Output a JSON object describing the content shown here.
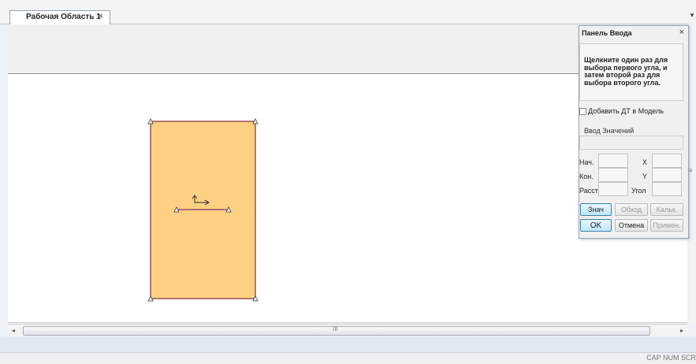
{
  "tabs": {
    "active_label": "Рабочая Область 1",
    "close_glyph": "×",
    "dropdown_glyph": "▾"
  },
  "scrollbar": {
    "left_arrow": "◂",
    "right_arrow": "▸",
    "grip": "III",
    "v_grip": "≡"
  },
  "status": {
    "indicators": "CAP NUM SCR"
  },
  "panel": {
    "title": "Панель Ввода",
    "close_glyph": "×",
    "message": "Щелкните один раз для выбора первого угла, и затем второй раз для выбора второго угла.",
    "add_dt_label": "Добавить ДТ в Модель",
    "add_dt_checked": false,
    "group_label": "Ввод Значений",
    "fields": {
      "start_label": "Нач.",
      "end_label": "Кон.",
      "dist_label": "Расст",
      "x_label": "X",
      "y_label": "Y",
      "angle_label": "Угол"
    },
    "buttons": {
      "values": "Знач",
      "bypass": "Обход",
      "calc": "Кальк.",
      "ok": "OK",
      "cancel": "Отмена",
      "apply": "Примен."
    }
  },
  "colors": {
    "rect_fill": "#fdd083",
    "rect_stroke": "#7b2e3e",
    "segment_stroke": "#7a3a6a",
    "accent_blue": "#3c7fb1"
  },
  "icons": {
    "tab_close": "close-icon",
    "panel_close": "close-icon",
    "vertex_markers": "triangle-marker-icon",
    "axis_glyph": "ucs-axes-icon"
  }
}
